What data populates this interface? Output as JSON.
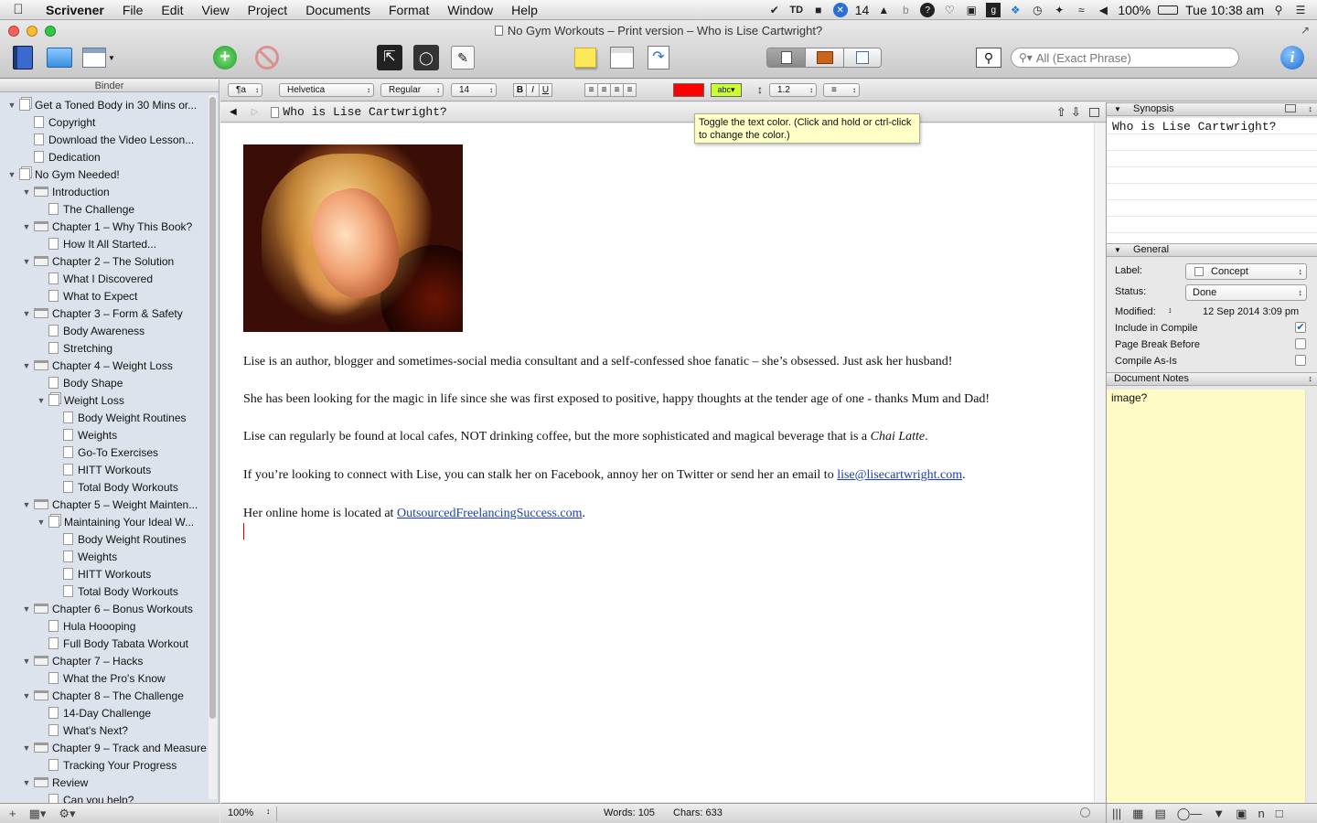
{
  "menubar": {
    "apple": "",
    "app": "Scrivener",
    "items": [
      "File",
      "Edit",
      "View",
      "Project",
      "Documents",
      "Format",
      "Window",
      "Help"
    ],
    "badge_count": "14",
    "battery": "100%",
    "clock": "Tue 10:38 am"
  },
  "window": {
    "title": "No Gym Workouts – Print version – Who is Lise Cartwright?"
  },
  "search": {
    "placeholder": "All (Exact Phrase)"
  },
  "binder": {
    "header": "Binder",
    "items": [
      {
        "label": "Get a Toned Body in 30 Mins or...",
        "level": 0,
        "icon": "document-stack",
        "expanded": true
      },
      {
        "label": "Copyright",
        "level": 1,
        "icon": "document"
      },
      {
        "label": "Download the Video Lesson...",
        "level": 1,
        "icon": "document"
      },
      {
        "label": "Dedication",
        "level": 1,
        "icon": "document"
      },
      {
        "label": "No Gym Needed!",
        "level": 0,
        "icon": "document-stack",
        "expanded": true
      },
      {
        "label": "Introduction",
        "level": 1,
        "icon": "folder",
        "expanded": true
      },
      {
        "label": "The Challenge",
        "level": 2,
        "icon": "document"
      },
      {
        "label": "Chapter 1 – Why This Book?",
        "level": 1,
        "icon": "folder",
        "expanded": true
      },
      {
        "label": "How It All Started...",
        "level": 2,
        "icon": "document"
      },
      {
        "label": "Chapter 2 – The Solution",
        "level": 1,
        "icon": "folder",
        "expanded": true
      },
      {
        "label": "What I Discovered",
        "level": 2,
        "icon": "document"
      },
      {
        "label": "What to Expect",
        "level": 2,
        "icon": "document"
      },
      {
        "label": "Chapter 3 – Form & Safety",
        "level": 1,
        "icon": "folder",
        "expanded": true
      },
      {
        "label": "Body Awareness",
        "level": 2,
        "icon": "document"
      },
      {
        "label": "Stretching",
        "level": 2,
        "icon": "document"
      },
      {
        "label": "Chapter 4 – Weight Loss",
        "level": 1,
        "icon": "folder",
        "expanded": true
      },
      {
        "label": "Body Shape",
        "level": 2,
        "icon": "document"
      },
      {
        "label": "Weight Loss",
        "level": 2,
        "icon": "document-stack",
        "expanded": true
      },
      {
        "label": "Body Weight Routines",
        "level": 3,
        "icon": "document"
      },
      {
        "label": "Weights",
        "level": 3,
        "icon": "document"
      },
      {
        "label": "Go-To Exercises",
        "level": 3,
        "icon": "document"
      },
      {
        "label": "HITT Workouts",
        "level": 3,
        "icon": "document"
      },
      {
        "label": "Total Body Workouts",
        "level": 3,
        "icon": "document"
      },
      {
        "label": "Chapter 5 – Weight Mainten...",
        "level": 1,
        "icon": "folder",
        "expanded": true
      },
      {
        "label": "Maintaining Your Ideal W...",
        "level": 2,
        "icon": "document-stack",
        "expanded": true
      },
      {
        "label": "Body Weight Routines",
        "level": 3,
        "icon": "document"
      },
      {
        "label": "Weights",
        "level": 3,
        "icon": "document"
      },
      {
        "label": "HITT Workouts",
        "level": 3,
        "icon": "document"
      },
      {
        "label": "Total Body Workouts",
        "level": 3,
        "icon": "document"
      },
      {
        "label": "Chapter 6 – Bonus Workouts",
        "level": 1,
        "icon": "folder",
        "expanded": true
      },
      {
        "label": "Hula Hoooping",
        "level": 2,
        "icon": "document"
      },
      {
        "label": "Full Body Tabata Workout",
        "level": 2,
        "icon": "document"
      },
      {
        "label": "Chapter 7 – Hacks",
        "level": 1,
        "icon": "folder",
        "expanded": true
      },
      {
        "label": "What the Pro's Know",
        "level": 2,
        "icon": "document"
      },
      {
        "label": "Chapter 8 – The Challenge",
        "level": 1,
        "icon": "folder",
        "expanded": true
      },
      {
        "label": "14-Day Challenge",
        "level": 2,
        "icon": "document"
      },
      {
        "label": "What's Next?",
        "level": 2,
        "icon": "document"
      },
      {
        "label": "Chapter 9 – Track and Measure",
        "level": 1,
        "icon": "folder",
        "expanded": true
      },
      {
        "label": "Tracking Your Progress",
        "level": 2,
        "icon": "document"
      },
      {
        "label": "Review",
        "level": 1,
        "icon": "folder",
        "expanded": true
      },
      {
        "label": "Can you help?",
        "level": 2,
        "icon": "document"
      }
    ]
  },
  "format_bar": {
    "paragraph_style": "¶a",
    "font_family": "Helvetica",
    "font_style": "Regular",
    "font_size": "14",
    "bold": "B",
    "italic": "I",
    "underline": "U",
    "text_color": "#ff0000",
    "highlight_label": "abc",
    "highlight_color": "#ccff33",
    "line_spacing": "1.2"
  },
  "editor": {
    "doc_title": "Who is Lise Cartwright?",
    "para1": "Lise is an author, blogger and sometimes-social media consultant and a self-confessed shoe fanatic – she’s obsessed. Just ask her husband!",
    "para2": "She has been looking for the magic in life since she was first exposed to positive, happy thoughts at the tender age of one - thanks Mum and Dad!",
    "para3_before": "Lise can regularly be found at local cafes, NOT drinking coffee, but the more sophisticated and magical beverage that is a ",
    "para3_em": "Chai Latte",
    "para3_after": ".",
    "para4_before": "If you’re looking to connect with Lise, you can stalk her on Facebook, annoy her on Twitter or send her an email to ",
    "para4_link": "lise@lisecartwright.com",
    "para4_after": ".",
    "para5_before": "Her online home is located at ",
    "para5_link": "OutsourcedFreelancingSuccess.com",
    "para5_after": "."
  },
  "tooltip": "Toggle the text color. (Click and hold or ctrl-click to change the color.)",
  "inspector": {
    "synopsis_header": "Synopsis",
    "synopsis_text": "Who is Lise Cartwright?",
    "general_header": "General",
    "label_label": "Label:",
    "label_value": "Concept",
    "status_label": "Status:",
    "status_value": "Done",
    "modified_label": "Modified:",
    "modified_value": "12 Sep 2014 3:09 pm",
    "include_label": "Include in Compile",
    "include_checked": true,
    "pagebreak_label": "Page Break Before",
    "compileas_label": "Compile As-Is",
    "notes_header": "Document Notes",
    "notes_text": "image?"
  },
  "status_bar": {
    "zoom": "100%",
    "words": "Words: 105",
    "chars": "Chars: 633"
  }
}
